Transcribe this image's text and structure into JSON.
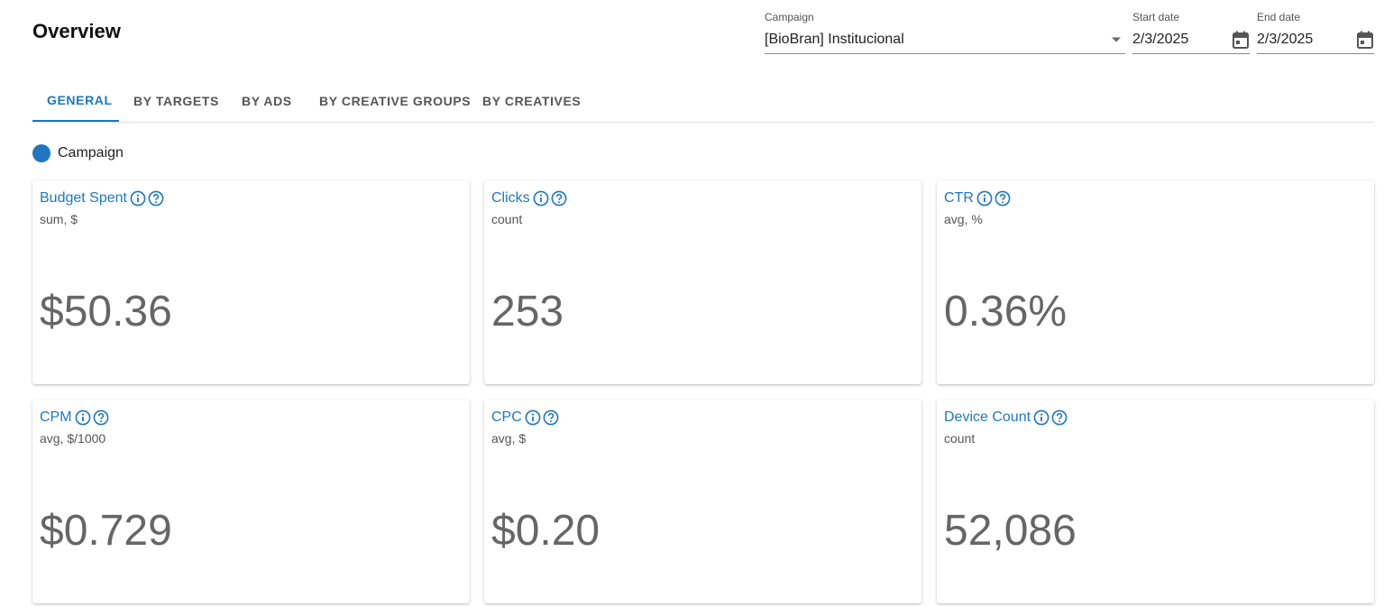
{
  "header": {
    "title": "Overview"
  },
  "filters": {
    "campaign": {
      "label": "Campaign",
      "value": "[BioBran] Institucional"
    },
    "start_date": {
      "label": "Start date",
      "value": "2/3/2025"
    },
    "end_date": {
      "label": "End date",
      "value": "2/3/2025"
    }
  },
  "tabs": [
    {
      "label": "GENERAL",
      "active": true
    },
    {
      "label": "BY TARGETS",
      "active": false
    },
    {
      "label": "BY ADS",
      "active": false
    },
    {
      "label": "BY CREATIVE GROUPS",
      "active": false
    },
    {
      "label": "BY CREATIVES",
      "active": false
    }
  ],
  "legend": {
    "label": "Campaign",
    "color": "#1f77c0"
  },
  "metrics": [
    {
      "title": "Budget Spent",
      "subtitle": "sum, $",
      "value": "$50.36"
    },
    {
      "title": "Clicks",
      "subtitle": "count",
      "value": "253"
    },
    {
      "title": "CTR",
      "subtitle": "avg, %",
      "value": "0.36%"
    },
    {
      "title": "CPM",
      "subtitle": "avg, $/1000",
      "value": "$0.729"
    },
    {
      "title": "CPC",
      "subtitle": "avg, $",
      "value": "$0.20"
    },
    {
      "title": "Device Count",
      "subtitle": "count",
      "value": "52,086"
    }
  ],
  "icons": {
    "info": "info-icon",
    "help": "help-icon",
    "dropdown": "dropdown-arrow-icon",
    "calendar": "calendar-icon"
  },
  "colors": {
    "accent": "#1f77c0",
    "value_text": "#666666"
  }
}
